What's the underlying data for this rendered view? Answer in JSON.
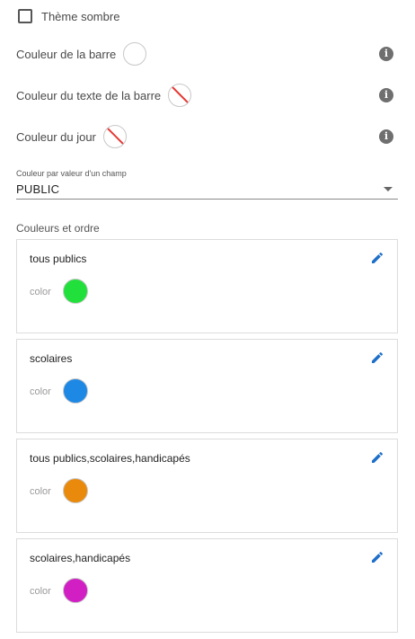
{
  "theme": {
    "label": "Thème sombre",
    "checked": false
  },
  "rows": [
    {
      "label": "Couleur de la barre",
      "swatch": "#ffffff"
    },
    {
      "label": "Couleur du texte de la barre",
      "swatch": "none"
    },
    {
      "label": "Couleur du jour",
      "swatch": "none"
    }
  ],
  "icons": {
    "info": "info-icon",
    "edit": "pencil-icon",
    "dropdown": "chevron-down-icon"
  },
  "select": {
    "label": "Couleur par valeur d'un champ",
    "value": "PUBLIC"
  },
  "section": {
    "title": "Couleurs et ordre"
  },
  "cards": [
    {
      "title": "tous publics",
      "color_label": "color",
      "color": "#22e03c"
    },
    {
      "title": "scolaires",
      "color_label": "color",
      "color": "#1e88e5"
    },
    {
      "title": "tous publics,scolaires,handicapés",
      "color_label": "color",
      "color": "#ea8a0c"
    },
    {
      "title": "scolaires,handicapés",
      "color_label": "color",
      "color": "#d11fc4"
    }
  ],
  "colors": {
    "accent": "#1e6fc8",
    "info_icon": "#6f6f6f",
    "none_slash": "#e53935"
  }
}
